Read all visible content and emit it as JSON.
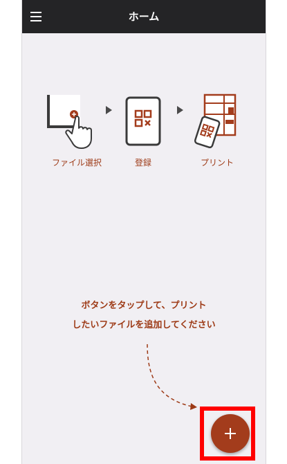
{
  "header": {
    "title": "ホーム"
  },
  "steps": [
    {
      "label": "ファイル選択",
      "icon": "tap-tablet-icon"
    },
    {
      "label": "登録",
      "icon": "qr-phone-icon"
    },
    {
      "label": "プリント",
      "icon": "printer-phone-icon"
    }
  ],
  "instruction": {
    "line1": "ボタンをタップして、プリント",
    "line2": "したいファイルを追加してください"
  },
  "colors": {
    "accent": "#a33c1c",
    "text_accent": "#9d3a16",
    "appbar": "#242426",
    "highlight": "#ff0000"
  }
}
